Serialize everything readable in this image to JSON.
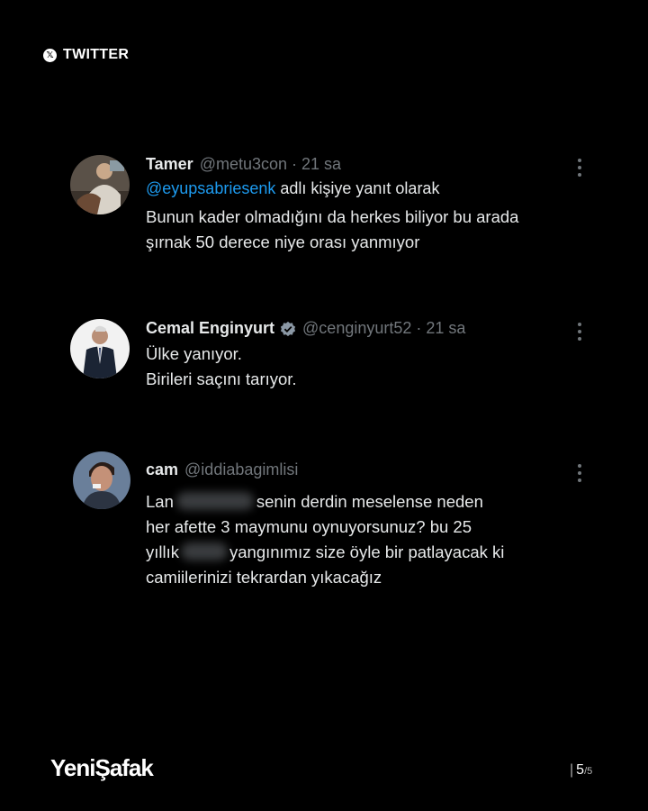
{
  "source": {
    "label": "TWITTER",
    "icon": "x-logo-icon"
  },
  "tweets": [
    {
      "name": "Tamer",
      "handle": "@metu3con",
      "dot": "·",
      "time": "21 sa",
      "reply_to": "@eyupsabriesenk",
      "reply_suffix": " adlı kişiye yanıt olarak",
      "lines": [
        "Bunun kader olmadığını da herkes biliyor bu arada",
        "şırnak 50 derece niye orası yanmıyor"
      ]
    },
    {
      "name": "Cemal Enginyurt",
      "verified": true,
      "handle": "@cenginyurt52",
      "dot": "·",
      "time": "21 sa",
      "lines": [
        "Ülke yanıyor.",
        "Birileri saçını tarıyor."
      ]
    },
    {
      "name": "cam",
      "handle": "@iddiabagimlisi",
      "lines": [
        {
          "before": "Lan",
          "after": "senin derdin meselense neden"
        },
        "her afette 3 maymunu oynuyorsunuz? bu 25",
        {
          "before": "yıllık",
          "after": "yangınımız size öyle bir patlayacak ki"
        },
        "camiilerinizi tekrardan yıkacağız"
      ]
    }
  ],
  "footer": {
    "brand": "YeniŞafak",
    "page_bar": "|",
    "page_current": "5",
    "page_total": "/5"
  },
  "colors": {
    "background": "#000000",
    "link": "#1d9bf0",
    "muted": "#71767b",
    "text": "#e7e9ea"
  }
}
